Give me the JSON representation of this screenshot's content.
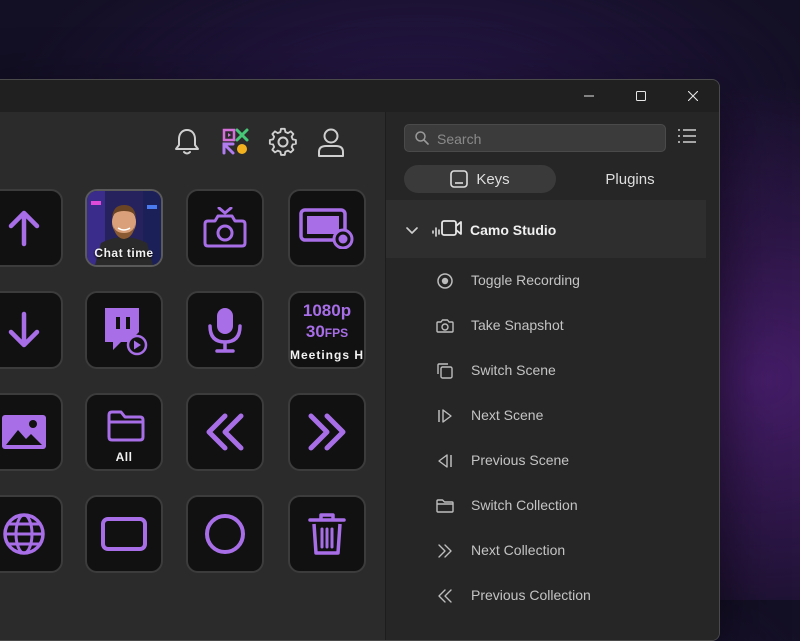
{
  "window": {
    "controls": [
      "minimize-icon",
      "maximize-icon",
      "close-icon"
    ]
  },
  "toolbar": {
    "icons": [
      "bell-icon",
      "camo-logo-icon",
      "gear-icon",
      "user-icon"
    ]
  },
  "keys": [
    {
      "icon": "arrow-up-icon",
      "label": ""
    },
    {
      "icon": "thumbnail-chat-time",
      "label": "Chat time"
    },
    {
      "icon": "camera-snapshot-icon",
      "label": ""
    },
    {
      "icon": "screen-record-icon",
      "label": ""
    },
    {
      "icon": "arrow-down-icon",
      "label": ""
    },
    {
      "icon": "twitch-play-icon",
      "label": ""
    },
    {
      "icon": "microphone-icon",
      "label": ""
    },
    {
      "icon": "video-format-icon",
      "label": "Meetings HD",
      "line1": "1080p",
      "line2": "30",
      "line2_suffix": "FPS"
    },
    {
      "icon": "image-icon",
      "label": ""
    },
    {
      "icon": "folder-icon",
      "label": "All"
    },
    {
      "icon": "double-chevron-left-icon",
      "label": ""
    },
    {
      "icon": "double-chevron-right-icon",
      "label": ""
    },
    {
      "icon": "globe-icon",
      "label": ""
    },
    {
      "icon": "rectangle-icon",
      "label": ""
    },
    {
      "icon": "circle-icon",
      "label": ""
    },
    {
      "icon": "trash-icon",
      "label": ""
    }
  ],
  "sidebar": {
    "search_placeholder": "Search",
    "tabs": [
      {
        "label": "Keys",
        "active": true
      },
      {
        "label": "Plugins",
        "active": false
      }
    ],
    "plugin": {
      "name": "Camo Studio",
      "expanded": true
    },
    "actions": [
      {
        "label": "Toggle Recording",
        "icon": "record-icon"
      },
      {
        "label": "Take Snapshot",
        "icon": "camera-icon"
      },
      {
        "label": "Switch Scene",
        "icon": "copy-scene-icon"
      },
      {
        "label": "Next Scene",
        "icon": "next-icon"
      },
      {
        "label": "Previous Scene",
        "icon": "previous-icon"
      },
      {
        "label": "Switch Collection",
        "icon": "folder-outline-icon"
      },
      {
        "label": "Next Collection",
        "icon": "double-chevron-right-icon"
      },
      {
        "label": "Previous Collection",
        "icon": "double-chevron-left-icon"
      }
    ]
  },
  "colors": {
    "accent": "#a86ee8",
    "key_bg": "#111111",
    "panel": "#2b2b2b"
  }
}
